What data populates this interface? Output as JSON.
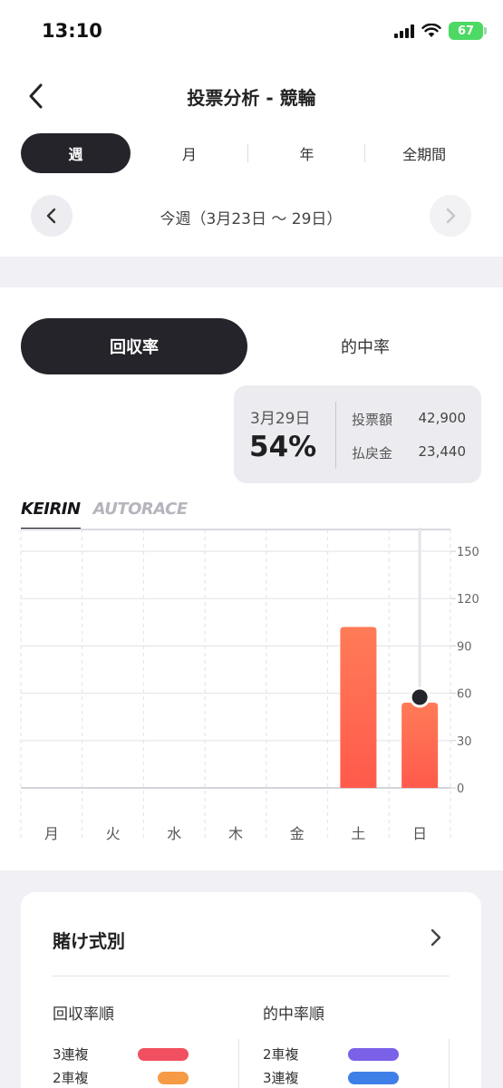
{
  "status_bar": {
    "time": "13:10",
    "battery": "67"
  },
  "header": {
    "title": "投票分析 - 競輪"
  },
  "period_tabs": [
    {
      "label": "週",
      "active": true
    },
    {
      "label": "月",
      "active": false
    },
    {
      "label": "年",
      "active": false
    },
    {
      "label": "全期間",
      "active": false
    }
  ],
  "week_nav": {
    "label": "今週（3月23日 〜 29日）"
  },
  "metric_tabs": [
    {
      "label": "回収率",
      "active": true
    },
    {
      "label": "的中率",
      "active": false
    }
  ],
  "tooltip": {
    "date": "3月29日",
    "percent": "54%",
    "bet_label": "投票額",
    "bet_value": "42,900",
    "payout_label": "払戻金",
    "payout_value": "23,440"
  },
  "brand_tabs": [
    {
      "label": "KEIRIN",
      "active": true
    },
    {
      "label": "AUTORACE",
      "active": false
    }
  ],
  "chart_data": {
    "type": "bar",
    "categories": [
      "月",
      "火",
      "水",
      "木",
      "金",
      "土",
      "日"
    ],
    "values": [
      0,
      0,
      0,
      0,
      0,
      102,
      54
    ],
    "ylim": [
      0,
      150
    ],
    "yticks": [
      0,
      30,
      60,
      90,
      120,
      150
    ],
    "grid": true,
    "selected_index": 6,
    "bar_color_top": "#ff7b57",
    "bar_color_bottom": "#ff5a4c"
  },
  "bet_type_card": {
    "title": "賭け式別",
    "left_title": "回収率順",
    "right_title": "的中率順",
    "left_rows": [
      {
        "label": "3連複",
        "color": "#f0505f",
        "fraction": 1.0
      },
      {
        "label": "2車複",
        "color": "#f69a45",
        "fraction": 0.6
      }
    ],
    "right_rows": [
      {
        "label": "2車複",
        "color": "#7b61e8",
        "fraction": 1.0
      },
      {
        "label": "3連複",
        "color": "#3f80e8",
        "fraction": 1.0
      }
    ]
  }
}
